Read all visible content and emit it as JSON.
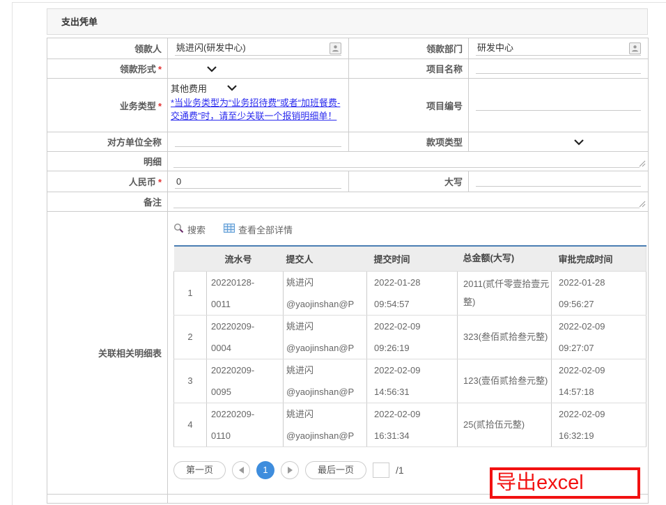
{
  "doc": {
    "title": "支出凭单"
  },
  "form": {
    "payee": {
      "label": "领款人",
      "value": "姚进闪(研发中心)"
    },
    "payee_dept": {
      "label": "领款部门",
      "value": "研发中心"
    },
    "payment_form": {
      "label": "领款形式",
      "req": "*"
    },
    "project_name": {
      "label": "项目名称",
      "value": ""
    },
    "business_type": {
      "label": "业务类型",
      "req": "*",
      "value": "其他费用",
      "note": "*当业务类型为“业务招待费”或者“加班餐费-交通费”时，请至少关联一个报销明细单！"
    },
    "project_no": {
      "label": "项目编号",
      "value": ""
    },
    "counterparty": {
      "label": "对方单位全称",
      "value": ""
    },
    "payment_type": {
      "label": "款项类型"
    },
    "detail": {
      "label": "明细",
      "value": ""
    },
    "rmb": {
      "label": "人民币",
      "req": "*",
      "value": "0"
    },
    "capital": {
      "label": "大写",
      "value": ""
    },
    "remark": {
      "label": "备注",
      "value": ""
    },
    "related": {
      "label": "关联相关明细表"
    }
  },
  "panel": {
    "toolbar": {
      "search": "搜索",
      "view_all": "查看全部详情"
    },
    "table": {
      "headers": [
        "",
        "流水号",
        "提交人",
        "提交时间",
        "总金额(大写)",
        "审批完成时间"
      ],
      "rows": [
        {
          "no": "1",
          "serial": [
            "20220128-",
            "0011"
          ],
          "submitter": [
            "姚进闪",
            "@yaojinshan@P"
          ],
          "submit_time": [
            "2022-01-28",
            "09:54:57"
          ],
          "amount": "2011(贰仟零壹拾壹元整)",
          "approve_time": [
            "2022-01-28",
            "09:56:27"
          ]
        },
        {
          "no": "2",
          "serial": [
            "20220209-",
            "0004"
          ],
          "submitter": [
            "姚进闪",
            "@yaojinshan@P"
          ],
          "submit_time": [
            "2022-02-09",
            "09:26:19"
          ],
          "amount": "323(叁佰贰拾叁元整)",
          "approve_time": [
            "2022-02-09",
            "09:27:07"
          ]
        },
        {
          "no": "3",
          "serial": [
            "20220209-",
            "0095"
          ],
          "submitter": [
            "姚进闪",
            "@yaojinshan@P"
          ],
          "submit_time": [
            "2022-02-09",
            "14:56:31"
          ],
          "amount": "123(壹佰贰拾叁元整)",
          "approve_time": [
            "2022-02-09",
            "14:57:18"
          ]
        },
        {
          "no": "4",
          "serial": [
            "20220209-",
            "0110"
          ],
          "submitter": [
            "姚进闪",
            "@yaojinshan@P"
          ],
          "submit_time": [
            "2022-02-09",
            "16:31:34"
          ],
          "amount": "25(贰拾伍元整)",
          "approve_time": [
            "2022-02-09",
            "16:32:19"
          ]
        }
      ]
    },
    "pagination": {
      "first": "第一页",
      "current": "1",
      "last": "最后一页",
      "total": "/1"
    },
    "export_label": "导出excel"
  },
  "icons": {
    "person": "person-icon",
    "search": "search-icon",
    "view_all": "table-grid-icon",
    "chevron": "chevron-down-icon",
    "resize": "resize-handle-icon",
    "prev": "prev-page-icon",
    "next": "next-page-icon"
  },
  "colors": {
    "accent_blue": "#3e8ddd",
    "table_top_border": "#4a7eb3",
    "note_blue": "#2b2bee",
    "required_red": "#e23030",
    "export_red": "#f21111",
    "grid_icon_blue": "#5b9bd5"
  }
}
